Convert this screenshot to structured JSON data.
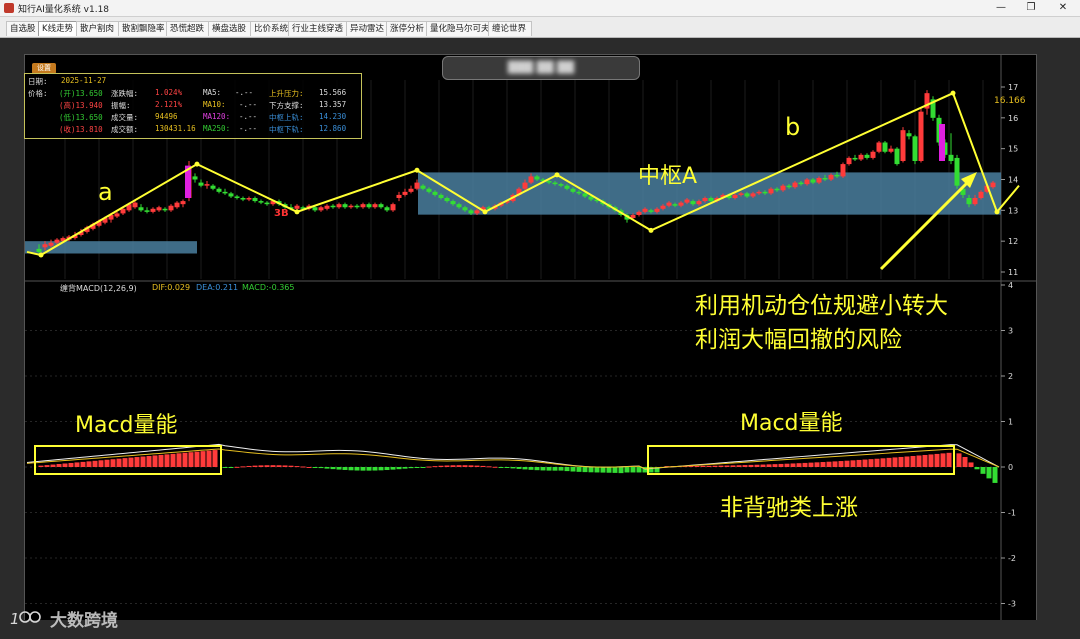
{
  "window": {
    "title": "知行AI量化系统 v1.18",
    "min": "—",
    "max": "❐",
    "close": "✕"
  },
  "tabs": [
    "自选股",
    "K线走势",
    "散户割肉",
    "散割飘隐率",
    "恐慌超跌",
    "横盘选股",
    "比价系统",
    "行业主线穿透",
    "异动雷达",
    "涨停分析",
    "量化隐马尔可夫",
    "缠论世界"
  ],
  "active_tab": 1,
  "stock_title": "███ ██ ██",
  "settings_label": "设置",
  "info": {
    "date_label": "日期:",
    "date": "2025-11-27",
    "price_label": "价格:",
    "open": "(开)13.650",
    "high": "(高)13.940",
    "low": "(低)13.650",
    "close": "(收)13.810",
    "change_label": "涨跌幅:",
    "change": "1.024%",
    "amplitude_label": "振幅:",
    "amplitude": "2.121%",
    "volume_label": "成交量:",
    "volume": "94496",
    "amount_label": "成交额:",
    "amount": "130431.16",
    "ma5_label": "MA5:",
    "ma5": "-.--",
    "ma10_label": "MA10:",
    "ma10": "-.--",
    "ma120_label": "MA120:",
    "ma120": "-.--",
    "ma250_label": "MA250:",
    "ma250": "-.--",
    "resist_label": "上升压力:",
    "resist": "15.566",
    "support_label": "下方支撑:",
    "support": "13.357",
    "pivot_up_label": "中枢上轨:",
    "pivot_up": "14.230",
    "pivot_down_label": "中枢下轨:",
    "pivot_down": "12.860"
  },
  "price_axis": [
    "17",
    "16",
    "15",
    "14",
    "13",
    "12",
    "11"
  ],
  "price_label_max": "16.166",
  "buy_mark": "3B",
  "macd_header": {
    "name": "缠背MACD(12,26,9)",
    "dif": "DIF:0.029",
    "dea": "DEA:0.211",
    "macd": "MACD:-0.365"
  },
  "macd_axis": [
    "4",
    "3",
    "2",
    "1",
    "0",
    "-1",
    "-2",
    "-3"
  ],
  "annotations": {
    "a": "a",
    "b": "b",
    "pivot": "中枢A",
    "note_line1": "利用机动仓位规避小转大",
    "note_line2": "利润大幅回撤的风险",
    "macd_energy_1": "Macd量能",
    "macd_energy_2": "Macd量能",
    "non_divergence": "非背驰类上涨"
  },
  "watermark": "大数跨境",
  "colors": {
    "up": "#ff3b3b",
    "down": "#33dd33",
    "pivot_zone": "#4a7f9f",
    "stroke": "#ffff33",
    "annot": "#ffff33"
  },
  "chart_data": {
    "type": "candlestick",
    "price_ylim": [
      11,
      17
    ],
    "pivot_zones": [
      {
        "low": 12.86,
        "high": 14.23
      }
    ],
    "macd_ylim": [
      -3,
      4
    ]
  }
}
